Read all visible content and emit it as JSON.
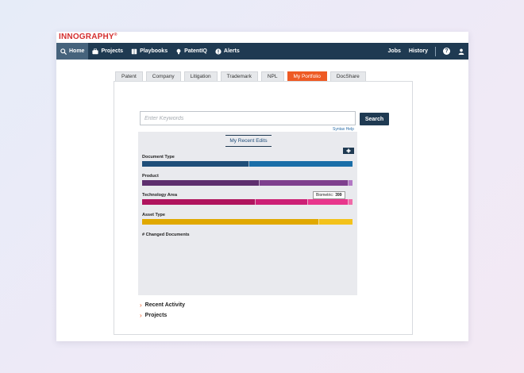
{
  "brand": {
    "name": "INNOGRAPHY",
    "mark": "®"
  },
  "topnav": {
    "items": [
      {
        "label": "Home",
        "icon": "search-icon",
        "active": true
      },
      {
        "label": "Projects",
        "icon": "briefcase-icon"
      },
      {
        "label": "Playbooks",
        "icon": "book-icon"
      },
      {
        "label": "PatentIQ",
        "icon": "lightbulb-icon"
      },
      {
        "label": "Alerts",
        "icon": "alert-icon"
      }
    ],
    "right": {
      "jobs": "Jobs",
      "history": "History",
      "help": "?"
    }
  },
  "tabs": [
    {
      "label": "Patent"
    },
    {
      "label": "Company"
    },
    {
      "label": "Litigation"
    },
    {
      "label": "Trademark"
    },
    {
      "label": "NPL"
    },
    {
      "label": "My Portfolio",
      "active": true
    },
    {
      "label": "DocShare"
    }
  ],
  "search": {
    "placeholder": "Enter Keywords",
    "button": "Search",
    "syntax_help": "Syntax Help"
  },
  "recent": {
    "title": "My Recent Edits",
    "gear_icon": "gear-icon",
    "categories": [
      {
        "label": "Document Type",
        "segments": [
          {
            "value": 51,
            "color": "#1f4e79"
          },
          {
            "value": 49,
            "color": "#1a6ea8"
          }
        ]
      },
      {
        "label": "Product",
        "segments": [
          {
            "value": 56,
            "color": "#5e2f6e"
          },
          {
            "value": 42,
            "color": "#7e3f8e"
          },
          {
            "value": 2,
            "color": "#b278c4"
          }
        ]
      },
      {
        "label": "Technology Area",
        "segments": [
          {
            "value": 54,
            "color": "#b0145e"
          },
          {
            "value": 25,
            "color": "#cc1f75"
          },
          {
            "value": 19,
            "color": "#e8368c"
          },
          {
            "value": 2,
            "color": "#f06aa8"
          }
        ]
      },
      {
        "label": "Asset Type",
        "segments": [
          {
            "value": 84,
            "color": "#e0a800"
          },
          {
            "value": 16,
            "color": "#f3c21b"
          }
        ]
      }
    ],
    "changed_label": "# Changed Documents",
    "tooltip": {
      "label": "Biometric:",
      "value": "399"
    }
  },
  "sections": [
    {
      "label": "Recent Activity"
    },
    {
      "label": "Projects"
    }
  ]
}
